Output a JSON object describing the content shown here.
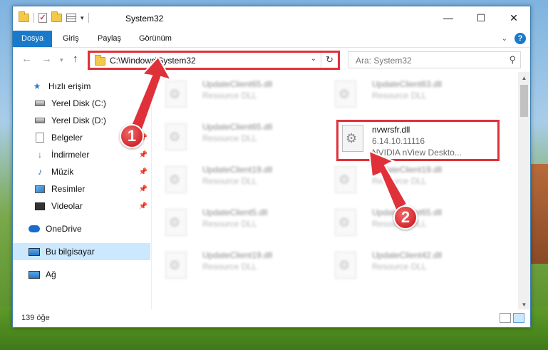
{
  "window": {
    "title": "System32",
    "buttons": {
      "minimize": "—",
      "maximize": "☐",
      "close": "✕"
    }
  },
  "ribbon": {
    "tabs": [
      {
        "label": "Dosya",
        "active": true
      },
      {
        "label": "Giriş"
      },
      {
        "label": "Paylaş"
      },
      {
        "label": "Görünüm"
      }
    ],
    "help": "?"
  },
  "navigation": {
    "address": "C:\\Windows\\System32",
    "search_placeholder": "Ara: System32"
  },
  "sidebar": {
    "items": [
      {
        "label": "Hızlı erişim",
        "icon": "star-icon"
      },
      {
        "label": "Yerel Disk (C:)",
        "icon": "drive-icon",
        "pinned": true
      },
      {
        "label": "Yerel Disk (D:)",
        "icon": "drive-icon",
        "pinned": true
      },
      {
        "label": "Belgeler",
        "icon": "documents-icon",
        "pinned": true
      },
      {
        "label": "İndirmeler",
        "icon": "download-icon",
        "pinned": true
      },
      {
        "label": "Müzik",
        "icon": "music-icon",
        "pinned": true
      },
      {
        "label": "Resimler",
        "icon": "pictures-icon",
        "pinned": true
      },
      {
        "label": "Videolar",
        "icon": "videos-icon",
        "pinned": true
      },
      {
        "label": "OneDrive",
        "icon": "onedrive-icon"
      },
      {
        "label": "Bu bilgisayar",
        "icon": "computer-icon",
        "selected": true
      },
      {
        "label": "Ağ",
        "icon": "network-icon"
      }
    ]
  },
  "files": {
    "left": [
      {
        "name": "UpdateClient65.dll",
        "desc": "Resource DLL"
      },
      {
        "name": "UpdateClient65.dll",
        "desc": "Resource DLL"
      },
      {
        "name": "UpdateClient19.dll",
        "desc": "Resource DLL"
      },
      {
        "name": "UpdateClient5.dll",
        "desc": "Resource DLL"
      },
      {
        "name": "UpdateClient19.dll",
        "desc": "Resource DLL"
      }
    ],
    "right": [
      {
        "name": "UpdateClient63.dll",
        "desc": "Resource DLL"
      },
      {
        "name": "UpdateClient19.dll",
        "desc": "Resource DLL"
      },
      {
        "name": "UpdateClient65.dll",
        "desc": "Resource DLL"
      },
      {
        "name": "UpdateClient42.dll",
        "desc": "Resource DLL"
      }
    ],
    "highlighted": {
      "name": "nvwrsfr.dll",
      "version": "6.14.10.11116",
      "desc": "NVIDIA nView Deskto..."
    }
  },
  "status": {
    "count": "139 öğe"
  },
  "callouts": {
    "one": "1",
    "two": "2"
  },
  "colors": {
    "accent": "#1979ca",
    "highlight": "#e0313a",
    "selected": "#cce8ff"
  }
}
